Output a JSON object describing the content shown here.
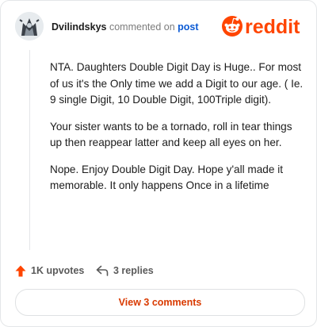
{
  "comment": {
    "username": "Dvilindskys",
    "commented_on": "commented on",
    "post_link": "post",
    "paragraphs": [
      "NTA. Daughters Double Digit Day is Huge.. For most of us it's the Only time we add a Digit to our age. ( Ie. 9 single Digit, 10 Double Digit, 100Triple digit).",
      "Your sister wants to be a tornado, roll in tear things up then reappear latter and keep all eyes on her.",
      "Nope. Enjoy Double Digit Day. Hope y'all made it memorable. It only happens Once in a lifetime"
    ]
  },
  "brand": {
    "wordmark": "reddit",
    "color": "#ff4500",
    "icon": "reddit-logo-icon"
  },
  "actions": {
    "upvotes_label": "1K upvotes",
    "upvote_icon": "upvote-arrow-icon",
    "upvote_color": "#ff4500",
    "replies_label": "3 replies",
    "reply_icon": "reply-arrow-icon"
  },
  "footer": {
    "view_comments_label": "View 3 comments",
    "accent": "#d93a00"
  }
}
